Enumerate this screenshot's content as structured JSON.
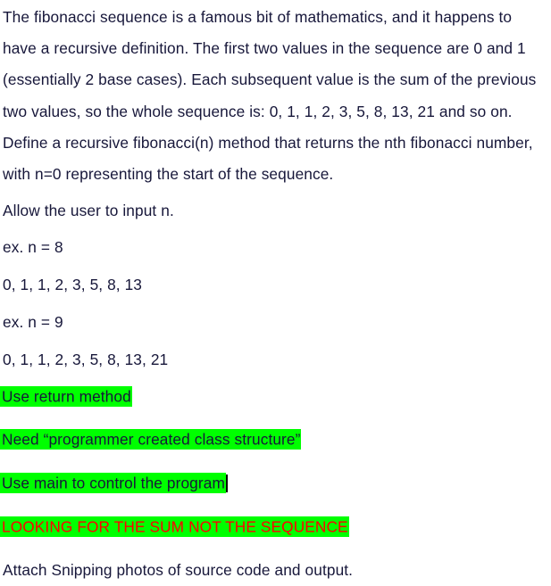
{
  "document": {
    "highlight_color": "#00ff00",
    "text_color": "#17173a",
    "emphasis_color": "#ff0000",
    "background_color": "#ffffff",
    "paragraphs": {
      "intro": "The fibonacci sequence is a famous bit of mathematics, and it happens to have a recursive definition. The first two values in the sequence are 0 and 1 (essentially 2 base cases). Each subsequent value is the sum of the previous two values, so the whole sequence is: 0, 1, 1, 2, 3, 5, 8, 13, 21 and so on. Define a recursive fibonacci(n) method that returns the nth fibonacci number, with n=0 representing the start of the sequence.",
      "allow_input": "Allow the user to input n.",
      "example_1_label": "ex. n = 8",
      "example_1_sequence": "0, 1, 1, 2, 3, 5, 8, 13",
      "example_2_label": "ex. n = 9",
      "example_2_sequence": "0, 1, 1, 2, 3, 5, 8, 13, 21",
      "requirement_1": "Use return method",
      "requirement_2": "Need “programmer created class structure”",
      "requirement_3": "Use main to control the program",
      "requirement_4": "LOOKING FOR THE SUM NOT THE SEQUENCE",
      "closing": "Attach Snipping photos of source code and output."
    }
  }
}
